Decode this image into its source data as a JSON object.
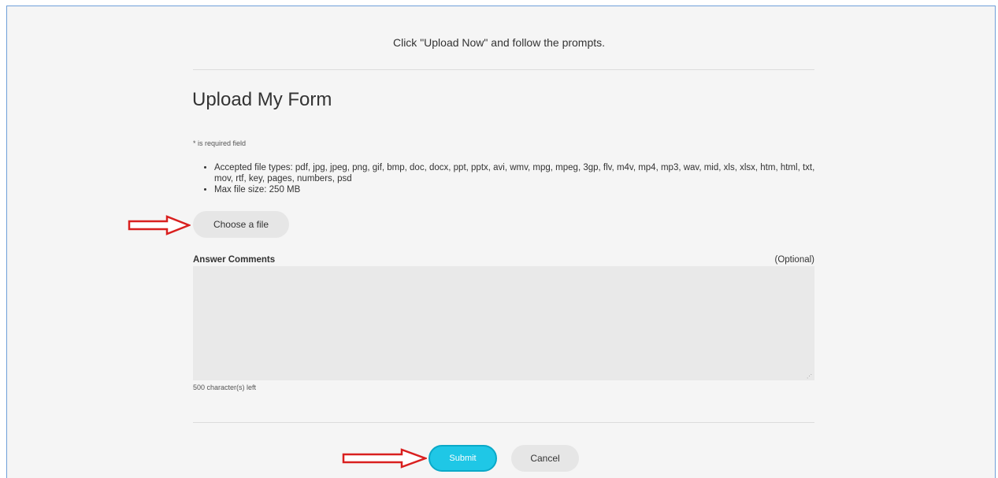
{
  "header": {
    "instruction": "Click \"Upload Now\" and follow the prompts."
  },
  "form": {
    "title": "Upload My Form",
    "required_note": "* is required field",
    "rules": [
      "Accepted file types: pdf, jpg, jpeg, png, gif, bmp, doc, docx, ppt, pptx, avi, wmv, mpg, mpeg, 3gp, flv, m4v, mp4, mp3, wav, mid, xls, xlsx, htm, html, txt, mov, rtf, key, pages, numbers, psd",
      "Max file size: 250 MB"
    ],
    "choose_file_label": "Choose a file",
    "comments_label": "Answer Comments",
    "comments_optional": "(Optional)",
    "comments_value": "",
    "chars_left": "500 character(s) left",
    "submit_label": "Submit",
    "cancel_label": "Cancel"
  },
  "colors": {
    "accent": "#1fc7e6",
    "annotation_arrow": "#d9201f",
    "frame_border": "#6f9fd8"
  },
  "annotations": {
    "arrow_icon": "right-arrow-outline-icon"
  }
}
